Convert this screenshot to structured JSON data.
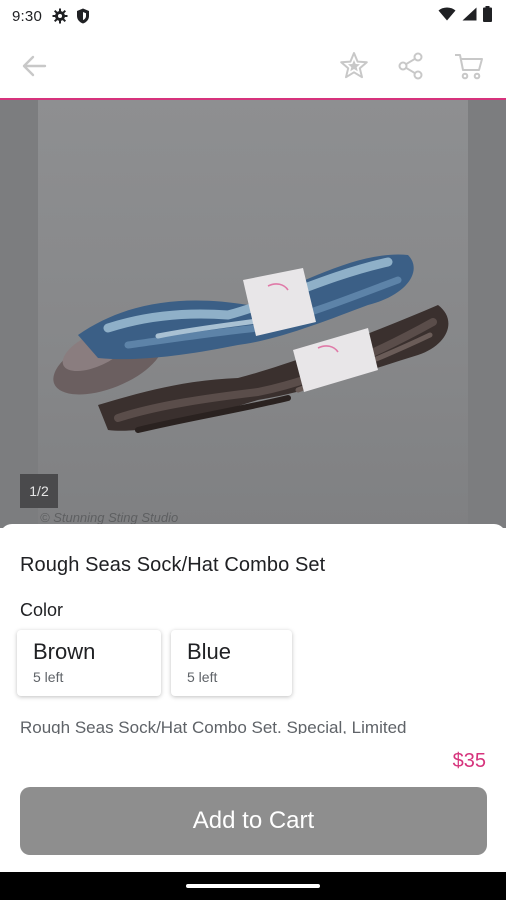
{
  "status_bar": {
    "time": "9:30",
    "icons": [
      "gear-icon",
      "shield-icon",
      "wifi-icon",
      "signal-icon",
      "battery-icon"
    ]
  },
  "toolbar": {
    "icons": [
      "back-arrow-icon",
      "star-icon",
      "share-icon",
      "cart-icon"
    ]
  },
  "gallery": {
    "counter": "1/2",
    "watermark": "© Stunning Sting Studio"
  },
  "product": {
    "title": "Rough Seas Sock/Hat Combo Set",
    "color_label": "Color",
    "options": [
      {
        "name": "Brown",
        "stock": "5 left"
      },
      {
        "name": "Blue",
        "stock": "5 left"
      }
    ],
    "description": "Rough Seas Sock/Hat Combo Set. Special, Limited"
  },
  "purchase": {
    "price": "$35",
    "button_label": "Add to Cart"
  },
  "colors": {
    "accent": "#d6337c",
    "button_disabled": "#8e8e8e"
  }
}
